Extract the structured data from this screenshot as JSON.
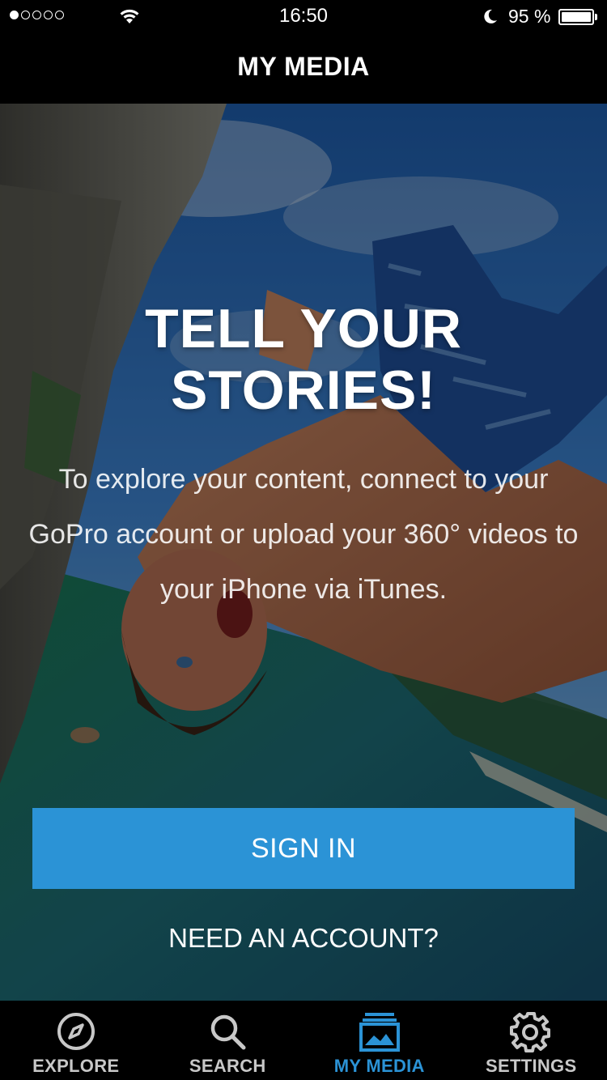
{
  "status_bar": {
    "signal_dots_filled": 1,
    "signal_dots_total": 5,
    "time": "16:50",
    "battery_percent": "95 %",
    "battery_level": 0.95
  },
  "nav": {
    "title": "MY MEDIA"
  },
  "hero": {
    "headline_line1": "TELL YOUR",
    "headline_line2": "STORIES!",
    "description": "To explore your content, connect to your GoPro account or upload your 360° videos to your iPhone via iTunes.",
    "sign_in_label": "SIGN IN",
    "need_account_label": "NEED AN ACCOUNT?"
  },
  "tabs": [
    {
      "label": "EXPLORE",
      "icon": "compass-icon",
      "active": false
    },
    {
      "label": "SEARCH",
      "icon": "search-icon",
      "active": false
    },
    {
      "label": "MY MEDIA",
      "icon": "media-icon",
      "active": true
    },
    {
      "label": "SETTINGS",
      "icon": "gear-icon",
      "active": false
    }
  ],
  "colors": {
    "accent": "#2b93d6",
    "tab_inactive": "#c8c8c8",
    "background": "#000000"
  }
}
